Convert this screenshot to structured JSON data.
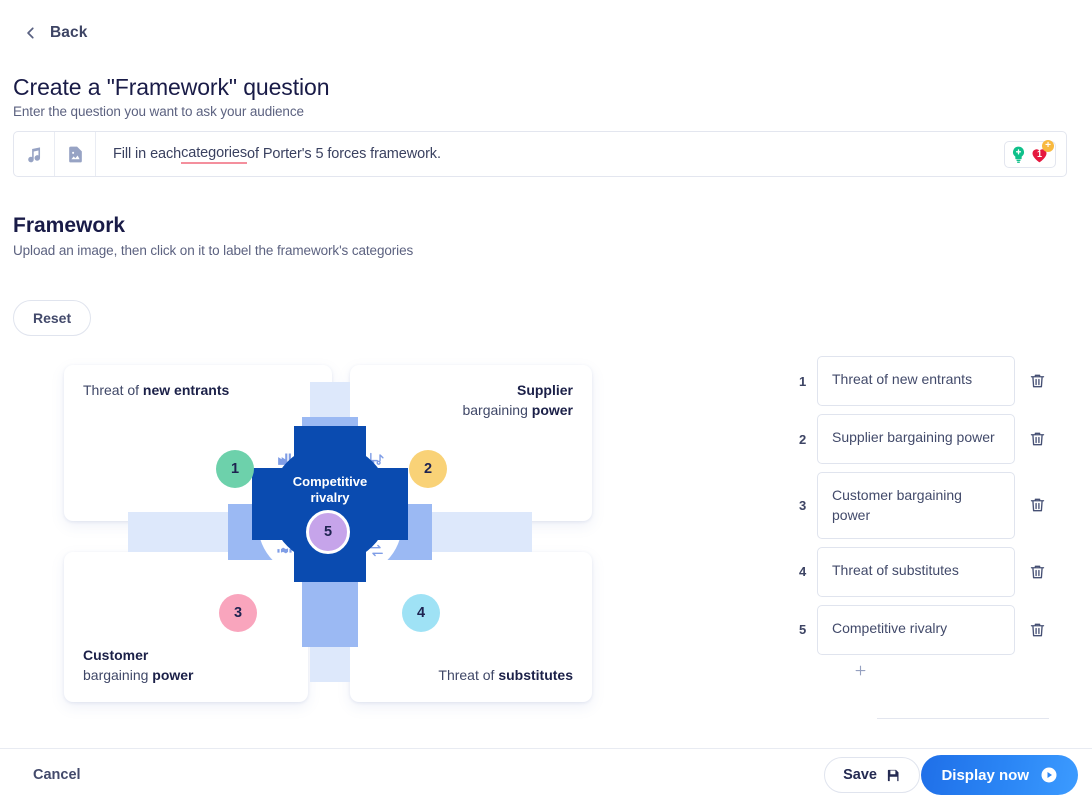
{
  "nav": {
    "back_label": "Back",
    "back_icon": "chevron-left-icon"
  },
  "header": {
    "title": "Create a \"Framework\" question",
    "subtitle": "Enter the question you want to ask your audience"
  },
  "question_bar": {
    "audio_icon": "music-note-icon",
    "image_icon": "image-icon",
    "text_before": "Fill in each ",
    "text_misspelled": "categories",
    "text_after": " of Porter's 5 forces framework.",
    "full_text": "Fill in each categories of Porter's 5 forces framework.",
    "bulb_icon": "lightbulb-icon",
    "heart_icon": "heart-icon",
    "heart_count": "1",
    "plus_badge": "+",
    "accent_misspell_color": "#f48f9d"
  },
  "framework": {
    "title": "Framework",
    "subtitle": "Upload an image, then click on it to label the framework's categories",
    "reset_label": "Reset"
  },
  "diagram": {
    "center_line1": "Competitive",
    "center_line2": "rivalry",
    "center_number": "5",
    "center_color": "#0a4bb0",
    "center_badge_color": "#c6a4ea",
    "cards": [
      {
        "prefix": "Threat of ",
        "bold": "new entrants",
        "suffix": "",
        "number": "1",
        "color": "#6dd1ab",
        "icon": "factory-icon"
      },
      {
        "prefix": "Supplier",
        "bold": "power",
        "suffix": "",
        "number": "2",
        "color": "#f9d277",
        "icon": "forklift-icon",
        "line1_bold": "Supplier",
        "line2_prefix": "bargaining ",
        "line2_bold": "power"
      },
      {
        "prefix": "Customer",
        "bold": "power",
        "suffix": "",
        "number": "3",
        "color": "#f9a5bd",
        "icon": "handshake-icon",
        "line1_bold": "Customer",
        "line2_prefix": "bargaining ",
        "line2_bold": "power"
      },
      {
        "prefix": "Threat of ",
        "bold": "substitutes",
        "suffix": "",
        "number": "4",
        "color": "#9fe2f5",
        "icon": "swap-icon"
      }
    ]
  },
  "answers": {
    "items": [
      {
        "num": "1",
        "value": "Threat of new entrants"
      },
      {
        "num": "2",
        "value": "Supplier bargaining power"
      },
      {
        "num": "3",
        "value": "Customer bargaining power"
      },
      {
        "num": "4",
        "value": "Threat of substitutes"
      },
      {
        "num": "5",
        "value": "Competitive rivalry"
      }
    ],
    "delete_icon": "trash-icon",
    "add_icon": "plus-icon"
  },
  "footer": {
    "cancel_label": "Cancel",
    "save_label": "Save",
    "save_icon": "floppy-disk-icon",
    "display_label": "Display now",
    "display_icon": "play-circle-icon",
    "display_color": "#2b86f5"
  }
}
